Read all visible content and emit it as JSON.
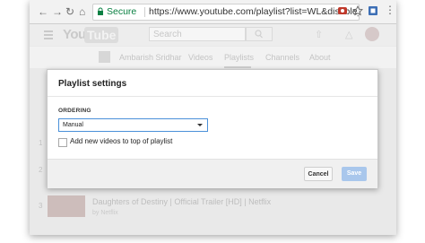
{
  "browser": {
    "back_glyph": "←",
    "forward_glyph": "→",
    "reload_glyph": "↻",
    "home_glyph": "⌂",
    "secure_label": "Secure",
    "url": "https://www.youtube.com/playlist?list=WL&disable_poly…",
    "menu_glyph": "⋮",
    "icons": [
      "lock-icon",
      "extension-icon",
      "star-icon",
      "extension-icon",
      "menu-icon"
    ]
  },
  "youtube": {
    "logo_you": "You",
    "logo_tube": "Tube",
    "search_placeholder": "Search",
    "upload_glyph": "⇧",
    "bell_glyph": "△",
    "channel_name": "Ambarish Sridhar",
    "channel_tabs": [
      "Videos",
      "Playlists",
      "Channels",
      "About"
    ],
    "row_numbers": [
      "1",
      "2",
      "3"
    ],
    "video_title": "Daughters of Destiny | Official Trailer [HD] | Netflix",
    "video_by": "by Netflix"
  },
  "dialog": {
    "title": "Playlist settings",
    "ordering_label": "ORDERING",
    "ordering_value": "Manual",
    "checkbox_label": "Add new videos to top of playlist",
    "checkbox_checked": false,
    "cancel_label": "Cancel",
    "save_label": "Save"
  },
  "colors": {
    "secure_green": "#0b8043",
    "select_focus_blue": "#4a90d9",
    "save_disabled_blue": "#a9c7ec"
  }
}
